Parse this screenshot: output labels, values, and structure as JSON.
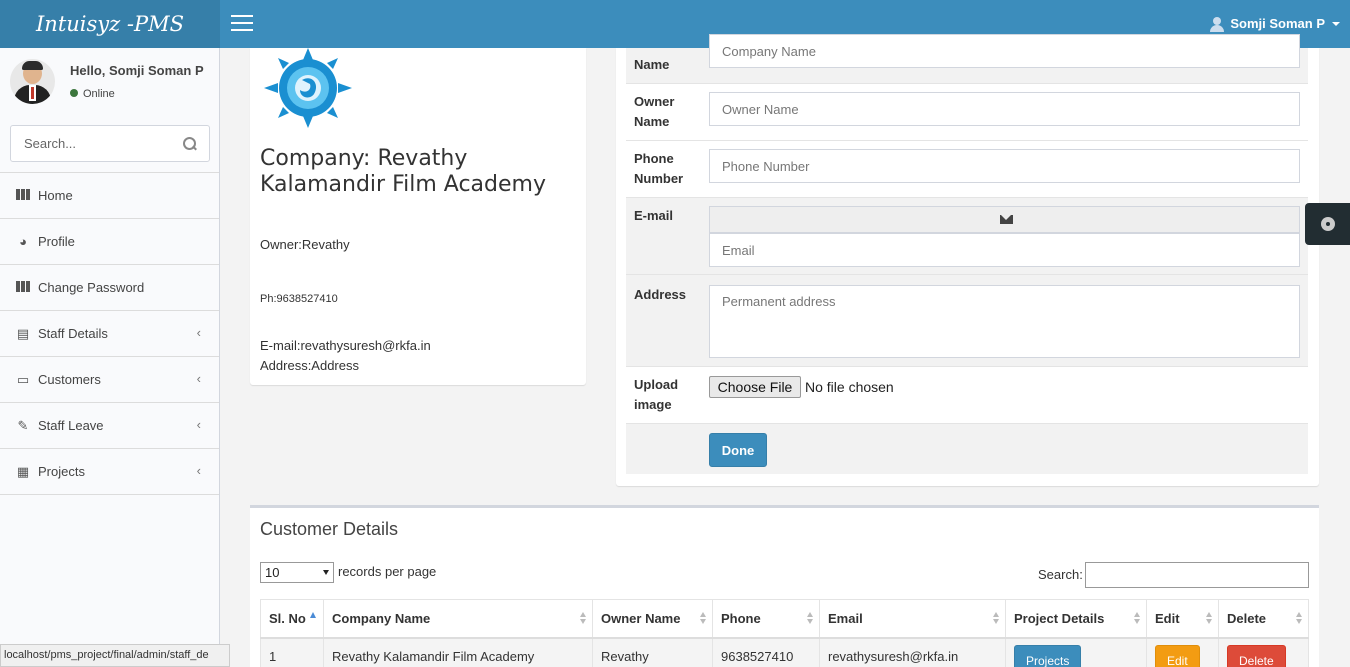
{
  "header": {
    "logo": "Intuisyz -PMS",
    "user_name": "Somji Soman P"
  },
  "sidebar": {
    "greeting": "Hello, Somji Soman P",
    "status": "Online",
    "search_placeholder": "Search...",
    "items": [
      {
        "label": "Home",
        "icon": "grid-icon",
        "has_submenu": false
      },
      {
        "label": "Profile",
        "icon": "dashboard-icon",
        "has_submenu": false
      },
      {
        "label": "Change Password",
        "icon": "grid-icon",
        "has_submenu": false
      },
      {
        "label": "Staff Details",
        "icon": "bar-chart-icon",
        "has_submenu": true
      },
      {
        "label": "Customers",
        "icon": "laptop-icon",
        "has_submenu": true
      },
      {
        "label": "Staff Leave",
        "icon": "edit-icon",
        "has_submenu": true
      },
      {
        "label": "Projects",
        "icon": "table-icon",
        "has_submenu": true
      }
    ]
  },
  "browser_status": "localhost/pms_project/final/admin/staff_de",
  "profile": {
    "company": "Company: Revathy Kalamandir Film Academy",
    "owner": "Owner:Revathy",
    "phone": "Ph:9638527410",
    "email": "E-mail:revathysuresh@rkfa.in",
    "address": "Address:Address"
  },
  "form": {
    "company_name_label": "Name",
    "company_name_placeholder": "Company Name",
    "owner_label": "Owner Name",
    "owner_placeholder": "Owner Name",
    "phone_label": "Phone Number",
    "phone_placeholder": "Phone Number",
    "email_label": "E-mail",
    "email_placeholder": "Email",
    "address_label": "Address",
    "address_placeholder": "Permanent address",
    "upload_label": "Upload image",
    "choose_file": "Choose File",
    "no_file": "No file chosen",
    "submit": "Done"
  },
  "customers": {
    "title": "Customer Details",
    "page_length": "10",
    "length_label": "records per page",
    "search_label": "Search:",
    "columns": [
      "Sl. No",
      "Company Name",
      "Owner Name",
      "Phone",
      "Email",
      "Project Details",
      "Edit",
      "Delete"
    ],
    "rows": [
      {
        "sl": "1",
        "company": "Revathy Kalamandir Film Academy",
        "owner": "Revathy",
        "phone": "9638527410",
        "email": "revathysuresh@rkfa.in",
        "projects_btn": "Projects",
        "edit_btn": "Edit",
        "delete_btn": "Delete"
      }
    ]
  },
  "colors": {
    "header": "#3c8dbc",
    "logo_bg": "#367fa9",
    "edit": "#f39c12",
    "delete": "#dd4b39"
  }
}
